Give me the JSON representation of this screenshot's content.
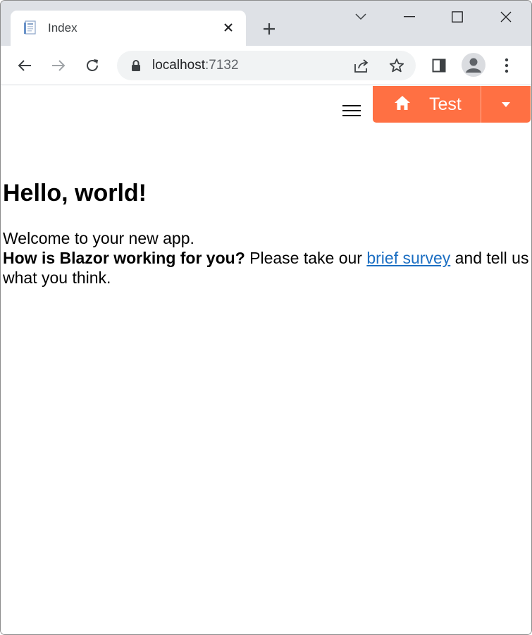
{
  "browser": {
    "tab": {
      "title": "Index",
      "favicon": "page-icon"
    },
    "controls": {
      "new_tab": "plus-icon",
      "tab_search": "chevron-down-icon",
      "minimize": "minimize-icon",
      "maximize": "maximize-icon",
      "close": "close-icon"
    },
    "toolbar": {
      "back": "back-arrow-icon",
      "forward": "forward-arrow-icon",
      "reload": "reload-icon",
      "url_host": "localhost",
      "url_port": ":7132",
      "share": "share-icon",
      "bookmark": "star-icon",
      "side_panel": "side-panel-icon",
      "profile": "avatar-icon",
      "menu": "kebab-menu-icon"
    }
  },
  "page": {
    "nav_toggle": "hamburger-icon",
    "split_button": {
      "label": "Test",
      "icon": "home-icon",
      "toggle_icon": "caret-down-icon",
      "color": "#ff7043"
    },
    "heading": "Hello, world!",
    "welcome": "Welcome to your new app.",
    "survey": {
      "bold": "How is Blazor working for you?",
      "before_link": " Please take our ",
      "link": "brief survey",
      "after_link": " and tell us what you think."
    },
    "link_color": "#1b6ec2"
  }
}
